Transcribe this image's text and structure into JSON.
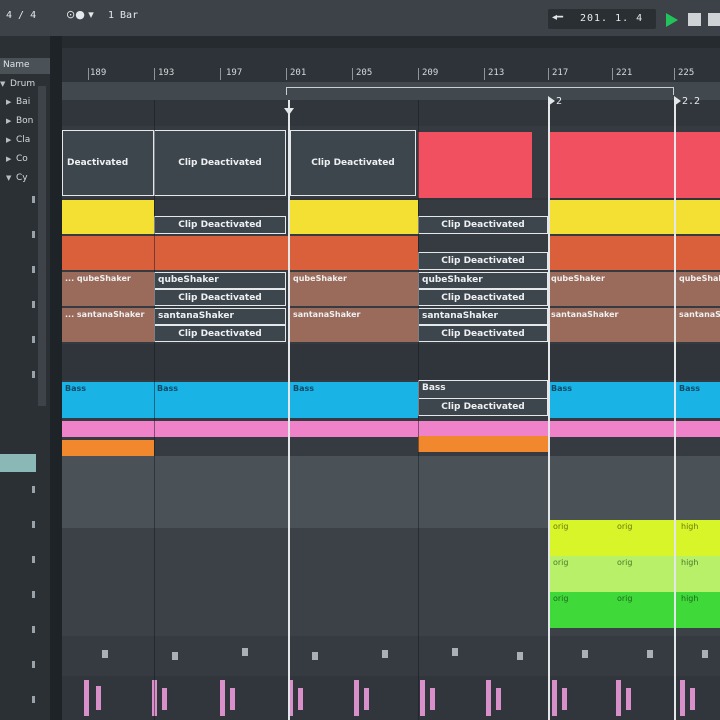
{
  "transport": {
    "time_signature": "4 / 4",
    "loop_icon": "loop-icon",
    "quantization": "1 Bar",
    "position_icon": "arrow-icon",
    "position": "201. 1. 4",
    "play_icon": "play-icon",
    "stop_icon": "stop-icon"
  },
  "browser": {
    "header": "Name",
    "items": [
      {
        "label": "Drum",
        "expanded": true
      },
      {
        "label": "Bai",
        "expanded": false
      },
      {
        "label": "Bon",
        "expanded": false
      },
      {
        "label": "Cla",
        "expanded": false
      },
      {
        "label": "Co",
        "expanded": false
      },
      {
        "label": "Cy",
        "expanded": true
      }
    ]
  },
  "ruler": {
    "bars": [
      "189",
      "193",
      "197",
      "201",
      "205",
      "209",
      "213",
      "217",
      "221",
      "225"
    ]
  },
  "locators": {
    "first": "2",
    "second": "2.2"
  },
  "clips": {
    "deactivated_label": "Clip Deactivated",
    "deactivated_short": "Deactivated",
    "qube": "qubeShaker",
    "qube_prefix": "... qubeShaker",
    "santana": "santanaShaker",
    "santana_prefix": "... santanaShaker",
    "bass": "Bass",
    "orig": "orig",
    "high": "high"
  },
  "colors": {
    "red": "#f0505f",
    "yellow": "#f4e033",
    "orange_red": "#d9603b",
    "brown": "#9a6a5a",
    "cyan": "#19b3e6",
    "pink": "#ef82c8",
    "orange": "#f2882e",
    "lime": "#d8f52a",
    "light_green": "#b8f06a",
    "green": "#40d93a"
  }
}
